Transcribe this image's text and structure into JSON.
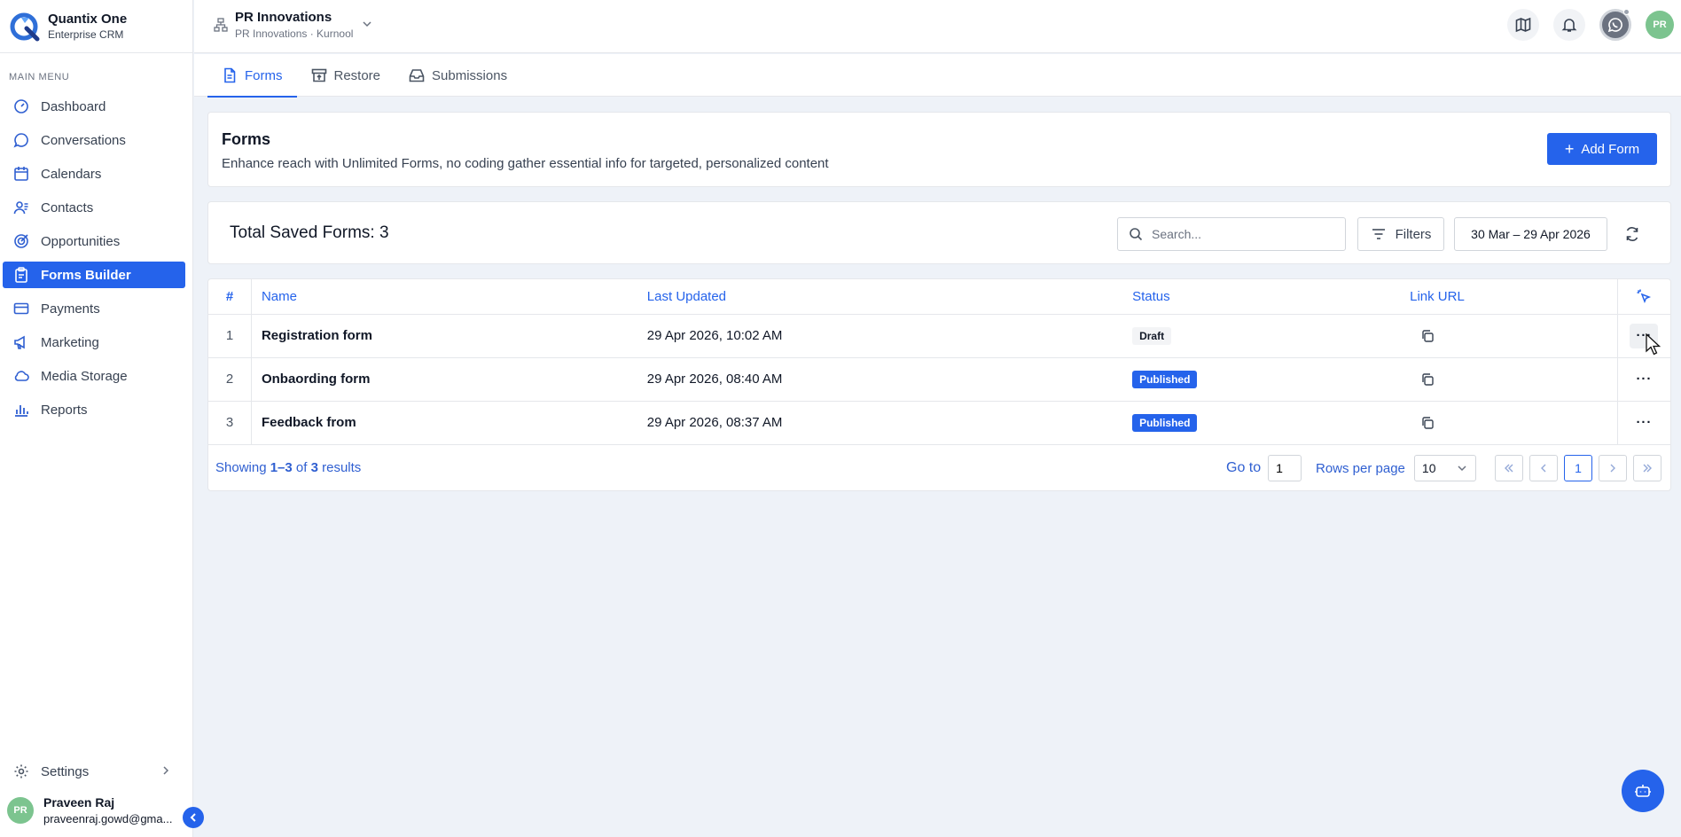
{
  "brand": {
    "name": "Quantix One",
    "subtitle": "Enterprise CRM"
  },
  "sidebar": {
    "menu_heading": "MAIN MENU",
    "items": [
      {
        "label": "Dashboard",
        "icon": "gauge-icon"
      },
      {
        "label": "Conversations",
        "icon": "chat-icon"
      },
      {
        "label": "Calendars",
        "icon": "calendar-icon"
      },
      {
        "label": "Contacts",
        "icon": "contacts-icon"
      },
      {
        "label": "Opportunities",
        "icon": "target-icon"
      },
      {
        "label": "Forms Builder",
        "icon": "clipboard-icon",
        "active": true
      },
      {
        "label": "Payments",
        "icon": "card-icon"
      },
      {
        "label": "Marketing",
        "icon": "megaphone-icon"
      },
      {
        "label": "Media Storage",
        "icon": "cloud-icon"
      },
      {
        "label": "Reports",
        "icon": "bar-chart-icon"
      }
    ],
    "settings_label": "Settings",
    "user": {
      "initials": "PR",
      "name": "Praveen Raj",
      "email": "praveenraj.gowd@gma..."
    }
  },
  "topbar": {
    "org_name": "PR Innovations",
    "org_sub": "PR Innovations · Kurnool",
    "avatar_initials": "PR"
  },
  "tabs": [
    {
      "label": "Forms",
      "icon": "document-icon",
      "active": true
    },
    {
      "label": "Restore",
      "icon": "archive-icon"
    },
    {
      "label": "Submissions",
      "icon": "inbox-icon"
    }
  ],
  "header": {
    "title": "Forms",
    "description": "Enhance reach with Unlimited Forms, no coding gather essential info for targeted, personalized content",
    "add_button": "Add Form"
  },
  "toolbar": {
    "total_label": "Total Saved Forms: 3",
    "search_placeholder": "Search...",
    "filters_label": "Filters",
    "date_range": "30 Mar – 29 Apr 2026"
  },
  "table": {
    "columns": [
      "#",
      "Name",
      "Last Updated",
      "Status",
      "Link URL"
    ],
    "rows": [
      {
        "num": "1",
        "name": "Registration form",
        "updated": "29 Apr 2026, 10:02 AM",
        "status": "Draft"
      },
      {
        "num": "2",
        "name": "Onbaording form",
        "updated": "29 Apr 2026, 08:40 AM",
        "status": "Published"
      },
      {
        "num": "3",
        "name": "Feedback from",
        "updated": "29 Apr 2026, 08:37 AM",
        "status": "Published"
      }
    ]
  },
  "pagination": {
    "showing_prefix": "Showing",
    "showing_range": "1–3",
    "showing_of": "of",
    "showing_total": "3",
    "showing_suffix": "results",
    "goto_label": "Go to",
    "goto_value": "1",
    "rows_per_page_label": "Rows per page",
    "rows_per_page": "10",
    "current_page": "1"
  },
  "colors": {
    "accent": "#2563eb",
    "avatar": "#7cc48f"
  }
}
